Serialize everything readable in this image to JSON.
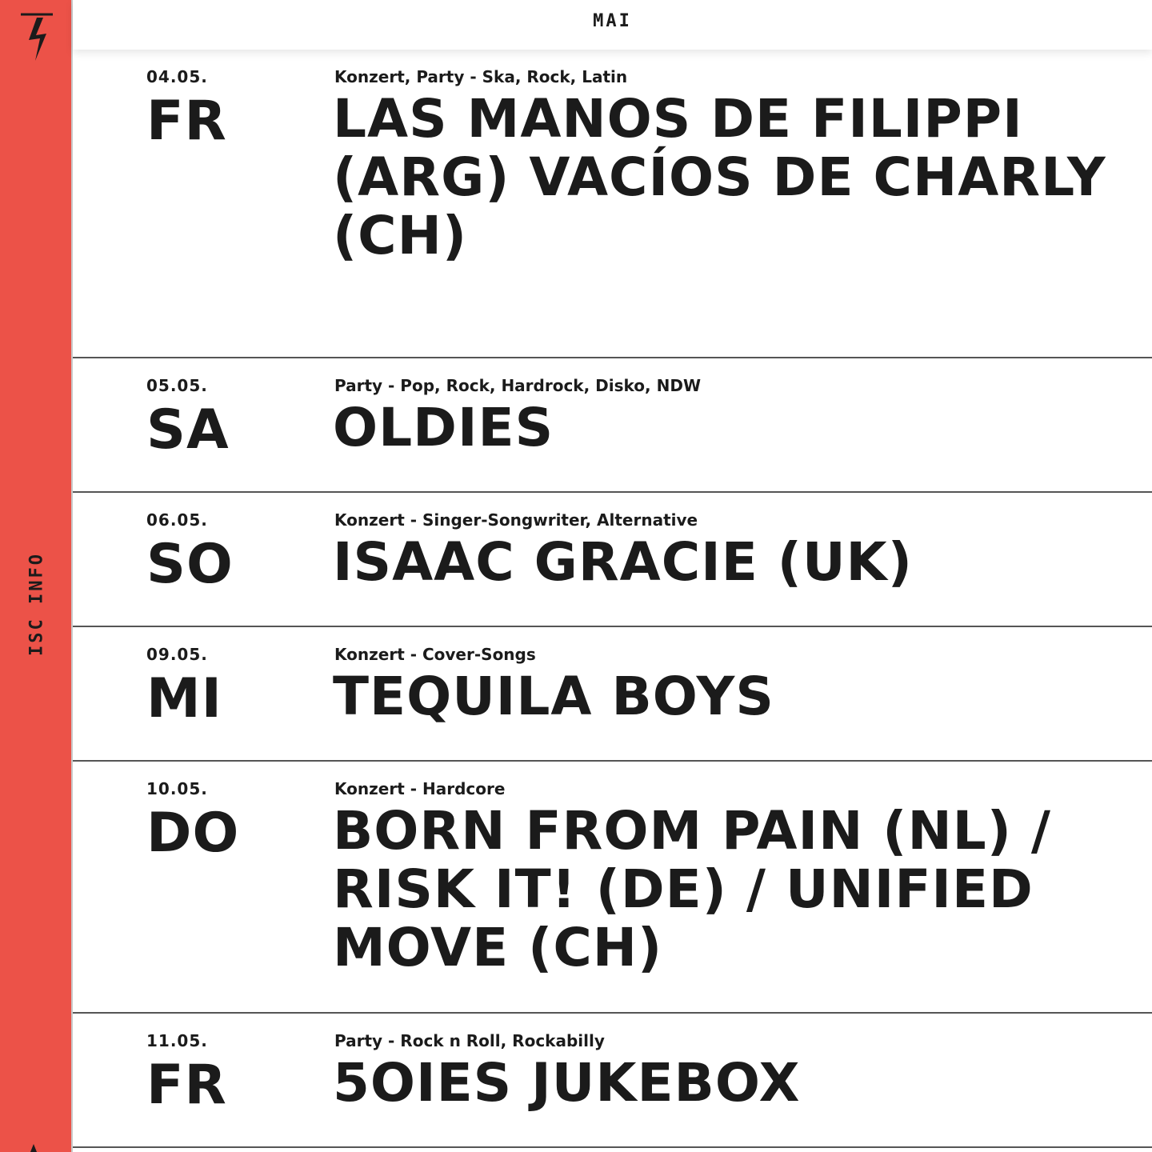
{
  "sidebar": {
    "label": "ISC INFO",
    "logo_icon": "lightning-logo-icon",
    "background": "#ec5248"
  },
  "month": "MAI",
  "events": [
    {
      "date": "04.05.",
      "weekday": "FR",
      "genre": "Konzert, Party - Ska, Rock, Latin",
      "title": "LAS MANOS DE FILIPPI (ARG) VACÍOS DE CHARLY (CH)"
    },
    {
      "date": "05.05.",
      "weekday": "SA",
      "genre": "Party - Pop, Rock, Hardrock, Disko, NDW",
      "title": "OLDIES"
    },
    {
      "date": "06.05.",
      "weekday": "SO",
      "genre": "Konzert - Singer-Songwriter, Alternative",
      "title": "ISAAC GRACIE (UK)"
    },
    {
      "date": "09.05.",
      "weekday": "MI",
      "genre": "Konzert - Cover-Songs",
      "title": "TEQUILA BOYS"
    },
    {
      "date": "10.05.",
      "weekday": "DO",
      "genre": "Konzert - Hardcore",
      "title": "BORN FROM PAIN (NL) / RISK IT! (DE) / UNIFIED MOVE (CH)"
    },
    {
      "date": "11.05.",
      "weekday": "FR",
      "genre": "Party - Rock n Roll, Rockabilly",
      "title": "5OIES JUKEBOX"
    }
  ]
}
